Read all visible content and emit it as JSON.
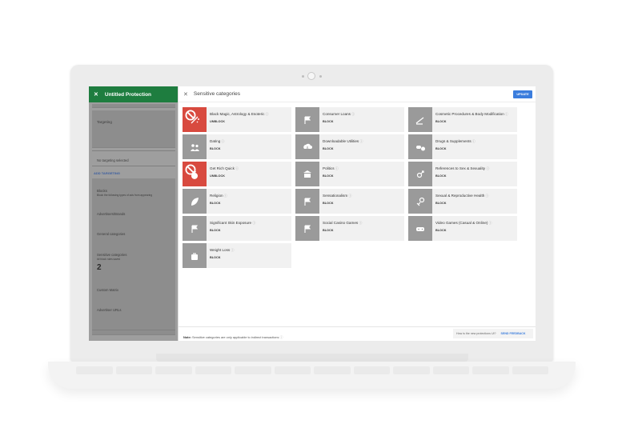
{
  "app": {
    "panel_title": "Untitled Protection"
  },
  "left_panel": {
    "targeting_label": "Targeting",
    "no_targeting": "No targeting selected",
    "add_targeting": "ADD TARGETING",
    "blocks_label": "Blocks",
    "blocks_desc": "Block the following types of ads from appearing",
    "advertisers_label": "Advertisers/Brands",
    "general_label": "General categories",
    "sensitive_label": "Sensitive categories",
    "sensitive_sub": "## block rules saved",
    "sensitive_count": "2",
    "custom_label": "Custom Matrix",
    "urls_label": "Advertiser URLs"
  },
  "dialog": {
    "title": "Sensitive categories",
    "update_button": "UPDATE",
    "footer_note_bold": "Note:",
    "footer_note": "Sensitive categories are only applicable to indirect transactions",
    "feedback_question": "How is the new protections UI?",
    "feedback_button": "SEND FEEDBACK"
  },
  "categories": [
    {
      "name": "Black Magic, Astrology & Esoteric",
      "action": "UNBLOCK",
      "blocked": true,
      "icon": "magic-icon"
    },
    {
      "name": "Consumer Loans",
      "action": "BLOCK",
      "blocked": false,
      "icon": "flag-icon"
    },
    {
      "name": "Cosmetic Procedures & Body Modification",
      "action": "BLOCK",
      "blocked": false,
      "icon": "scalpel-icon"
    },
    {
      "name": "Dating",
      "action": "BLOCK",
      "blocked": false,
      "icon": "people-icon"
    },
    {
      "name": "Downloadable Utilities",
      "action": "BLOCK",
      "blocked": false,
      "icon": "download-cloud-icon"
    },
    {
      "name": "Drugs & Supplements",
      "action": "BLOCK",
      "blocked": false,
      "icon": "pills-icon"
    },
    {
      "name": "Get Rich Quick",
      "action": "UNBLOCK",
      "blocked": true,
      "icon": "money-bag-icon"
    },
    {
      "name": "Politics",
      "action": "BLOCK",
      "blocked": false,
      "icon": "capitol-icon"
    },
    {
      "name": "References to Sex & Sexuality",
      "action": "BLOCK",
      "blocked": false,
      "icon": "gender-icon"
    },
    {
      "name": "Religion",
      "action": "BLOCK",
      "blocked": false,
      "icon": "leaf-icon"
    },
    {
      "name": "Sensationalism",
      "action": "BLOCK",
      "blocked": false,
      "icon": "flag-icon"
    },
    {
      "name": "Sexual & Reproductive Health",
      "action": "BLOCK",
      "blocked": false,
      "icon": "health-icon"
    },
    {
      "name": "Significant Skin Exposure",
      "action": "BLOCK",
      "blocked": false,
      "icon": "flag-icon"
    },
    {
      "name": "Social Casino Games",
      "action": "BLOCK",
      "blocked": false,
      "icon": "flag-icon"
    },
    {
      "name": "Video Games (Casual & Online)",
      "action": "BLOCK",
      "blocked": false,
      "icon": "gamepad-icon"
    },
    {
      "name": "Weight Loss",
      "action": "BLOCK",
      "blocked": false,
      "icon": "scale-icon"
    }
  ],
  "colors": {
    "blocked": "#d84a3f",
    "unblocked_icon": "#9a9a9a",
    "header_green": "#1e7d3f",
    "accent_blue": "#3b7ddd"
  }
}
